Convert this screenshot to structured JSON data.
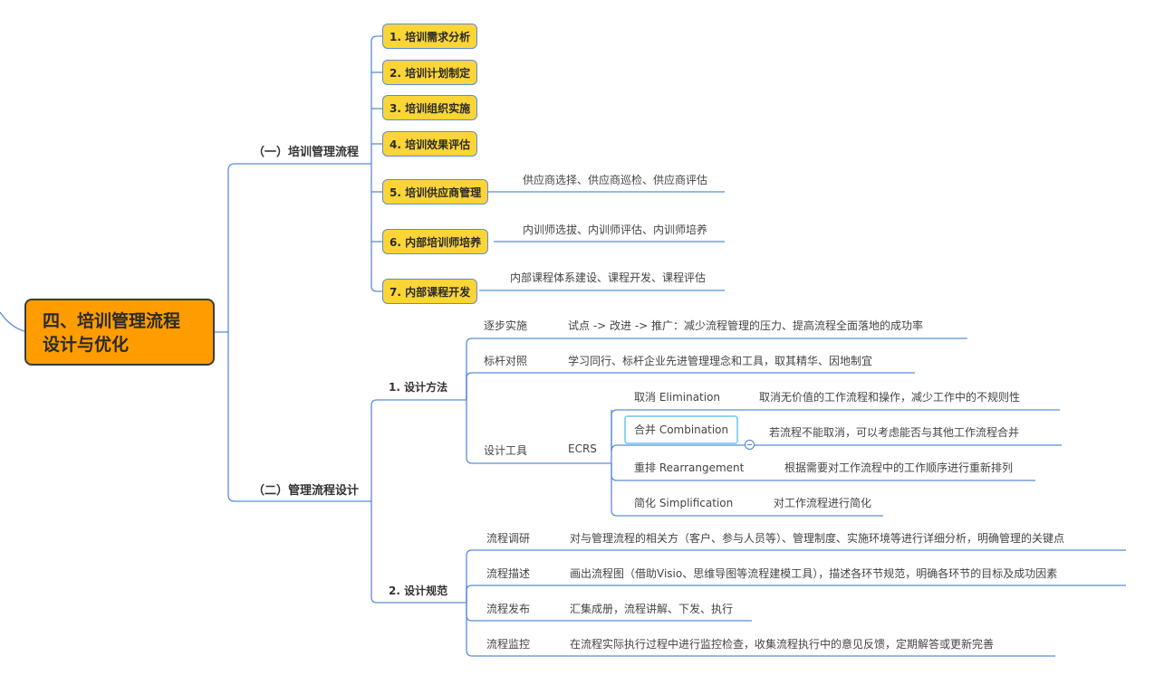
{
  "root": {
    "title_line1": "四、培训管理流程",
    "title_line2": "设计与优化"
  },
  "branches": [
    {
      "label": "（一）培训管理流程",
      "children": [
        {
          "label": "1. 培训需求分析"
        },
        {
          "label": "2. 培训计划制定"
        },
        {
          "label": "3. 培训组织实施"
        },
        {
          "label": "4. 培训效果评估"
        },
        {
          "label": "5. 培训供应商管理",
          "detail": "供应商选择、供应商巡检、供应商评估"
        },
        {
          "label": "6. 内部培训师培养",
          "detail": "内训师选拔、内训师评估、内训师培养"
        },
        {
          "label": "7. 内部课程开发",
          "detail": "内部课程体系建设、课程开发、课程评估"
        }
      ]
    },
    {
      "label": "（二）管理流程设计",
      "children": [
        {
          "label": "1. 设计方法",
          "children": [
            {
              "label": "逐步实施",
              "detail": "试点 -> 改进 -> 推广：减少流程管理的压力、提高流程全面落地的成功率"
            },
            {
              "label": "标杆对照",
              "detail": "学习同行、标杆企业先进管理理念和工具，取其精华、因地制宜"
            },
            {
              "label": "设计工具",
              "sub": "ECRS",
              "children": [
                {
                  "label": "取消 Elimination",
                  "detail": "取消无价值的工作流程和操作，减少工作中的不规则性"
                },
                {
                  "label": "合并 Combination",
                  "detail": "若流程不能取消，可以考虑能否与其他工作流程合并"
                },
                {
                  "label": "重排 Rearrangement",
                  "detail": "根据需要对工作流程中的工作顺序进行重新排列"
                },
                {
                  "label": "简化 Simplification",
                  "detail": "对工作流程进行简化"
                }
              ]
            }
          ]
        },
        {
          "label": "2. 设计规范",
          "children": [
            {
              "label": "流程调研",
              "detail": "对与管理流程的相关方（客户、参与人员等）、管理制度、实施环境等进行详细分析，明确管理的关键点"
            },
            {
              "label": "流程描述",
              "detail": "画出流程图（借助Visio、思维导图等流程建模工具），描述各环节规范，明确各环节的目标及成功因素"
            },
            {
              "label": "流程发布",
              "detail": "汇集成册，流程讲解、下发、执行"
            },
            {
              "label": "流程监控",
              "detail": "在流程实际执行过程中进行监控检查，收集流程执行中的意见反馈，定期解答或更新完善"
            }
          ]
        }
      ]
    }
  ],
  "colors": {
    "line": "#5b8dd6",
    "root_fill": "#ff9d00",
    "topic_fill": "#fbd537",
    "selection": "#8fd3f5"
  }
}
